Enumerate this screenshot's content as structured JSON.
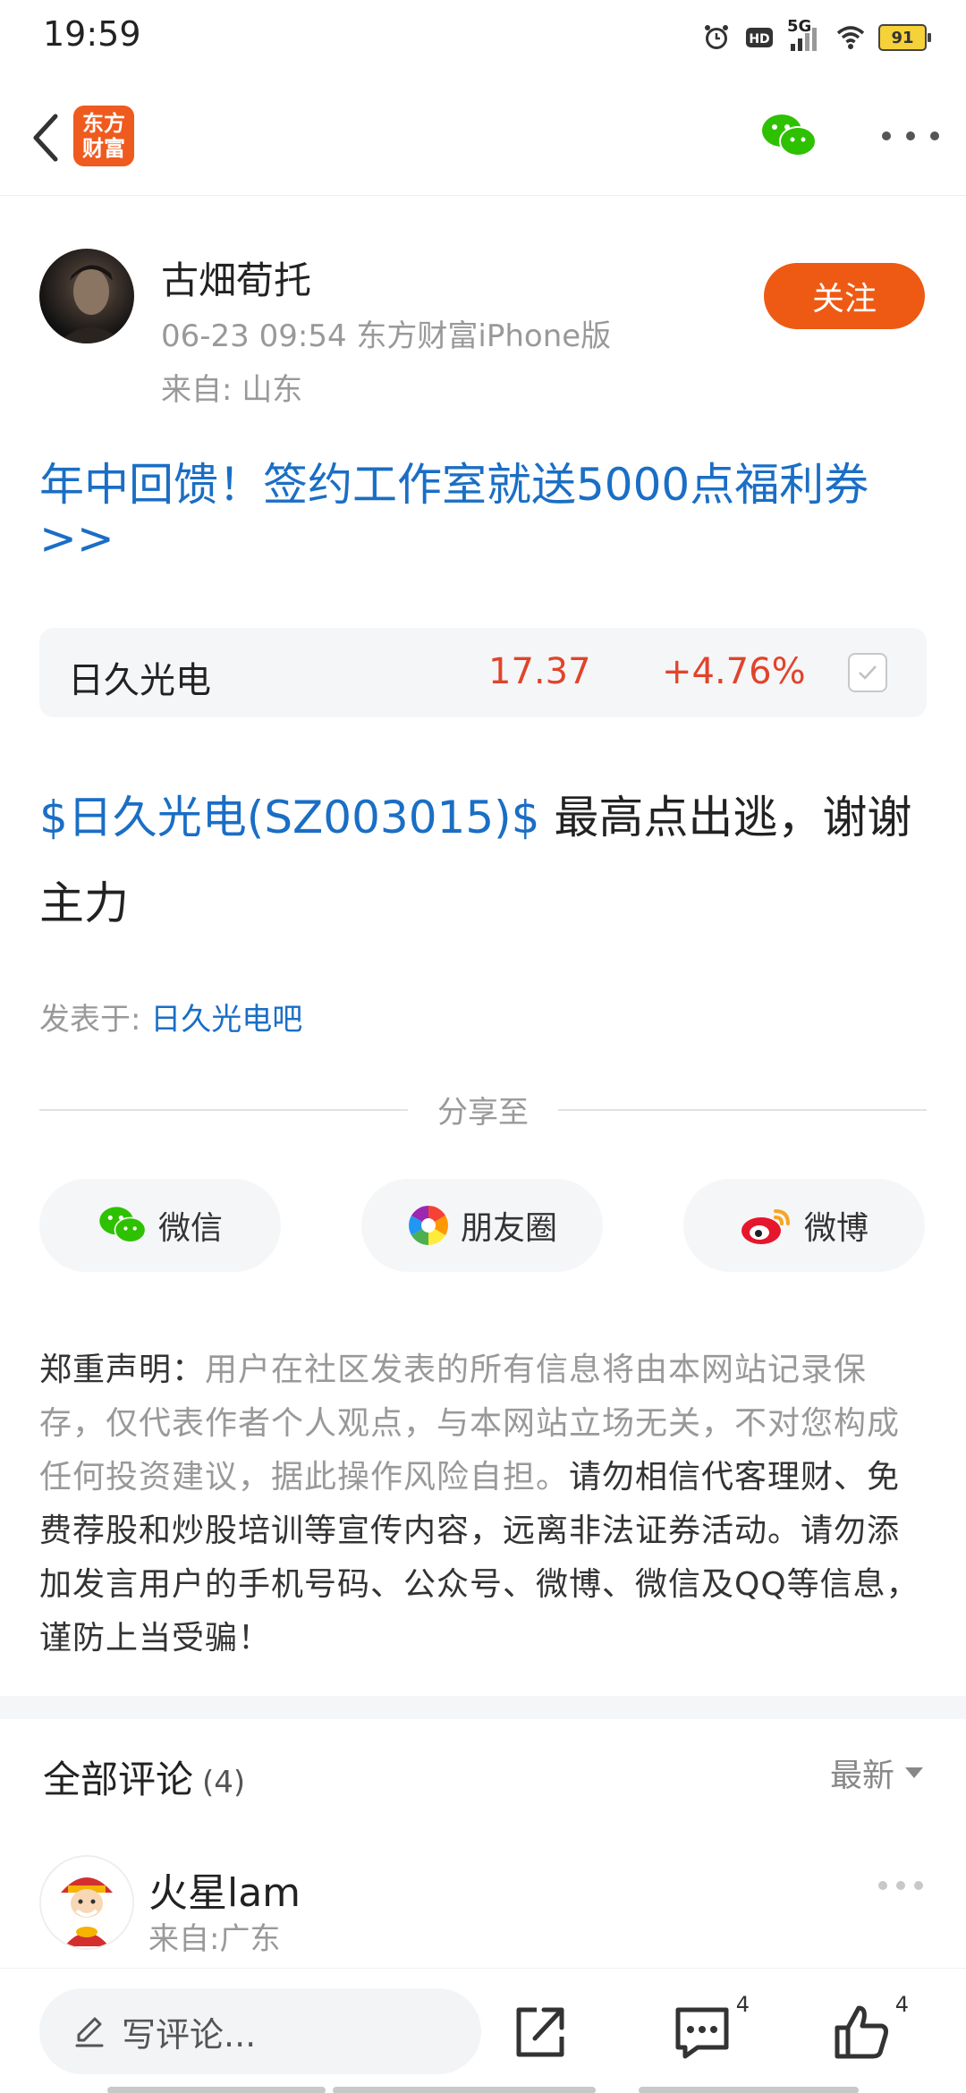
{
  "status_bar": {
    "time": "19:59",
    "network": "5G",
    "battery": "91",
    "icons": [
      "alarm-icon",
      "hd-icon",
      "signal-icon",
      "wifi-icon",
      "battery-icon"
    ]
  },
  "nav": {
    "logo_text": "东方财富",
    "icons": [
      "back-icon",
      "wechat-icon",
      "more-icon"
    ]
  },
  "author": {
    "name": "古畑荀托",
    "meta": "06-23 09:54 东方财富iPhone版",
    "location": "来自: 山东",
    "follow_label": "关注"
  },
  "promo": {
    "text": "年中回馈！签约工作室就送5000点福利券>>"
  },
  "stock": {
    "name": "日久光电",
    "price": "17.37",
    "change": "+4.76%"
  },
  "post": {
    "stock_tag": "$日久光电(SZ003015)$",
    "text": " 最高点出逃，谢谢主力",
    "posted_in_label": "发表于: ",
    "forum": "日久光电吧"
  },
  "share": {
    "title": "分享至",
    "options": [
      {
        "label": "微信",
        "icon": "wechat-icon"
      },
      {
        "label": "朋友圈",
        "icon": "moments-icon"
      },
      {
        "label": "微博",
        "icon": "weibo-icon"
      }
    ]
  },
  "disclaimer": {
    "label": "郑重声明：",
    "muted": "用户在社区发表的所有信息将由本网站记录保存，仅代表作者个人观点，与本网站立场无关，不对您构成任何投资建议，据此操作风险自担。",
    "strong": "请勿相信代客理财、免费荐股和炒股培训等宣传内容，远离非法证券活动。请勿添加发言用户的手机号码、公众号、微博、微信及QQ等信息，谨防上当受骗！"
  },
  "comments": {
    "title": "全部评论",
    "count": "(4)",
    "sort_label": "最新",
    "first": {
      "user": "火星lam",
      "location": "来自:广东"
    }
  },
  "bottom_bar": {
    "input_placeholder": "写评论...",
    "comment_count": "4",
    "like_count": "4"
  },
  "colors": {
    "brand_orange": "#ee5a14",
    "link_blue": "#1a6ec5",
    "price_red": "#e0442b"
  }
}
